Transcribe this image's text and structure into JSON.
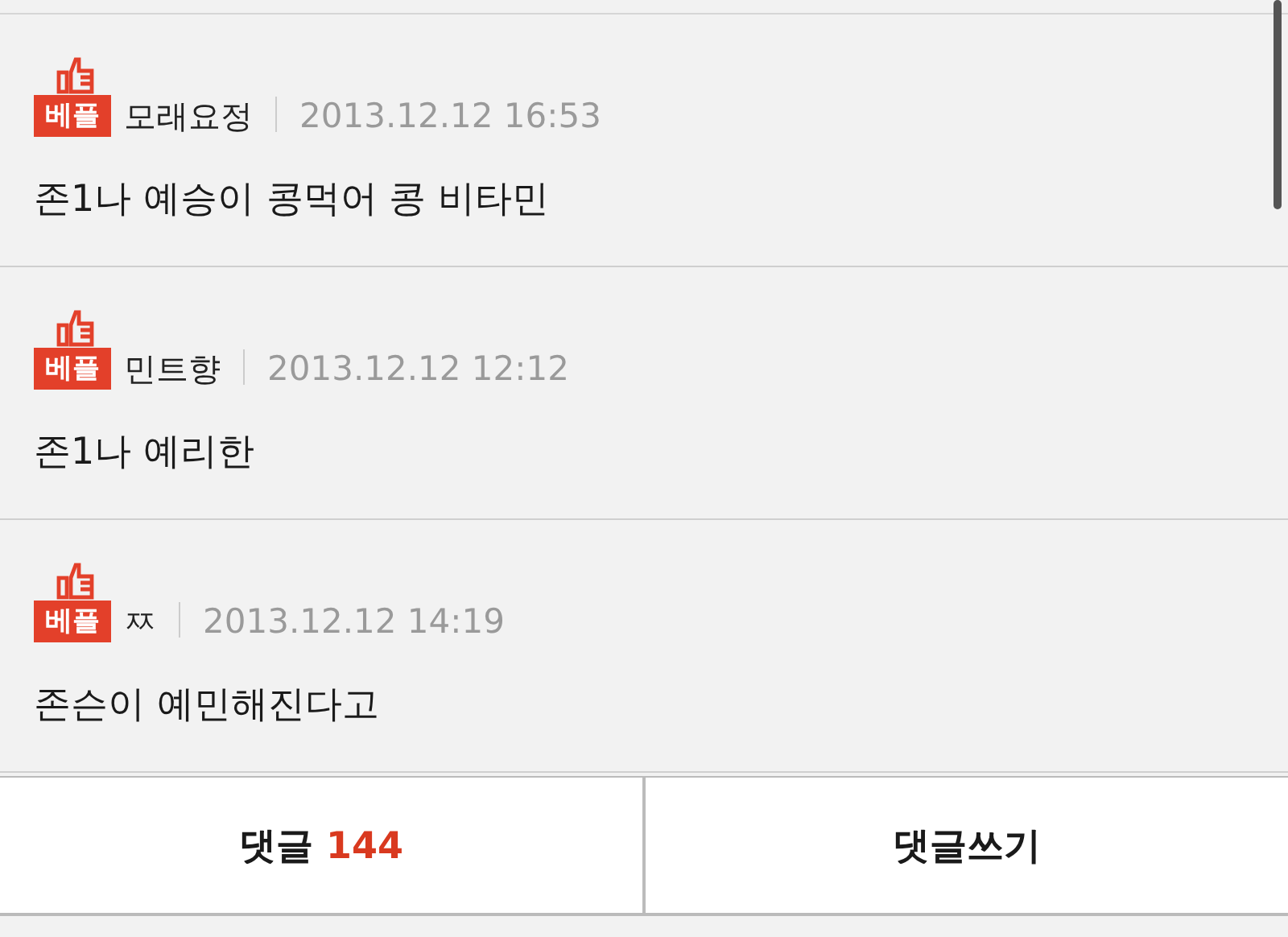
{
  "comments": [
    {
      "badge": "베플",
      "author": "모래요정",
      "date": "2013.12.12 16:53",
      "text": "존1나 예승이 콩먹어 콩 비타민"
    },
    {
      "badge": "베플",
      "author": "민트향",
      "date": "2013.12.12 12:12",
      "text": "존1나 예리한"
    },
    {
      "badge": "베플",
      "author": "ㅉ",
      "date": "2013.12.12 14:19",
      "text": "존슨이 예민해진다고"
    }
  ],
  "footer": {
    "comments_button": {
      "label": "댓글",
      "count": "144"
    },
    "write_button": {
      "label": "댓글쓰기"
    }
  }
}
